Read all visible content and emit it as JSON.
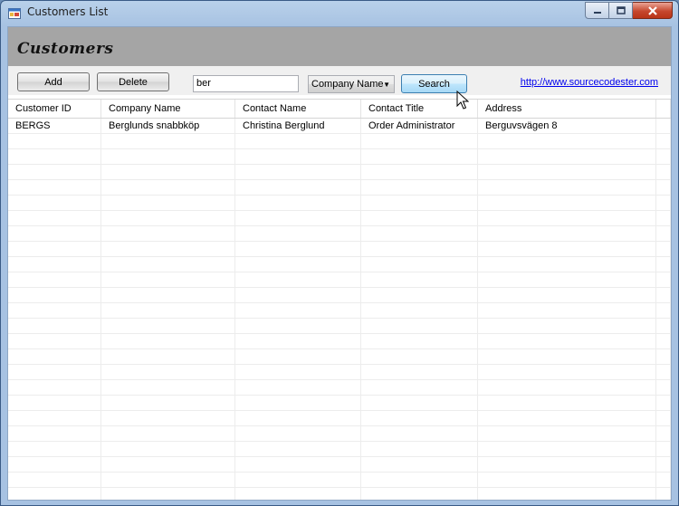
{
  "window": {
    "title": "Customers List"
  },
  "header": {
    "title": "Customers"
  },
  "toolbar": {
    "add_label": "Add",
    "delete_label": "Delete",
    "search_value": "ber",
    "filter_field": "Company Name",
    "search_label": "Search",
    "link_text": "http://www.sourcecodester.com"
  },
  "grid": {
    "columns": [
      "Customer ID",
      "Company Name",
      "Contact Name",
      "Contact Title",
      "Address"
    ],
    "rows": [
      [
        "BERGS",
        "Berglunds snabbköp",
        "Christina Berglund",
        "Order Administrator",
        "Berguvsvägen  8"
      ]
    ]
  },
  "icons": {
    "app": "app-window-icon",
    "minimize": "minimize-icon",
    "maximize": "maximize-icon",
    "close": "close-icon",
    "dropdown": "chevron-down-icon",
    "cursor": "mouse-pointer-icon"
  }
}
